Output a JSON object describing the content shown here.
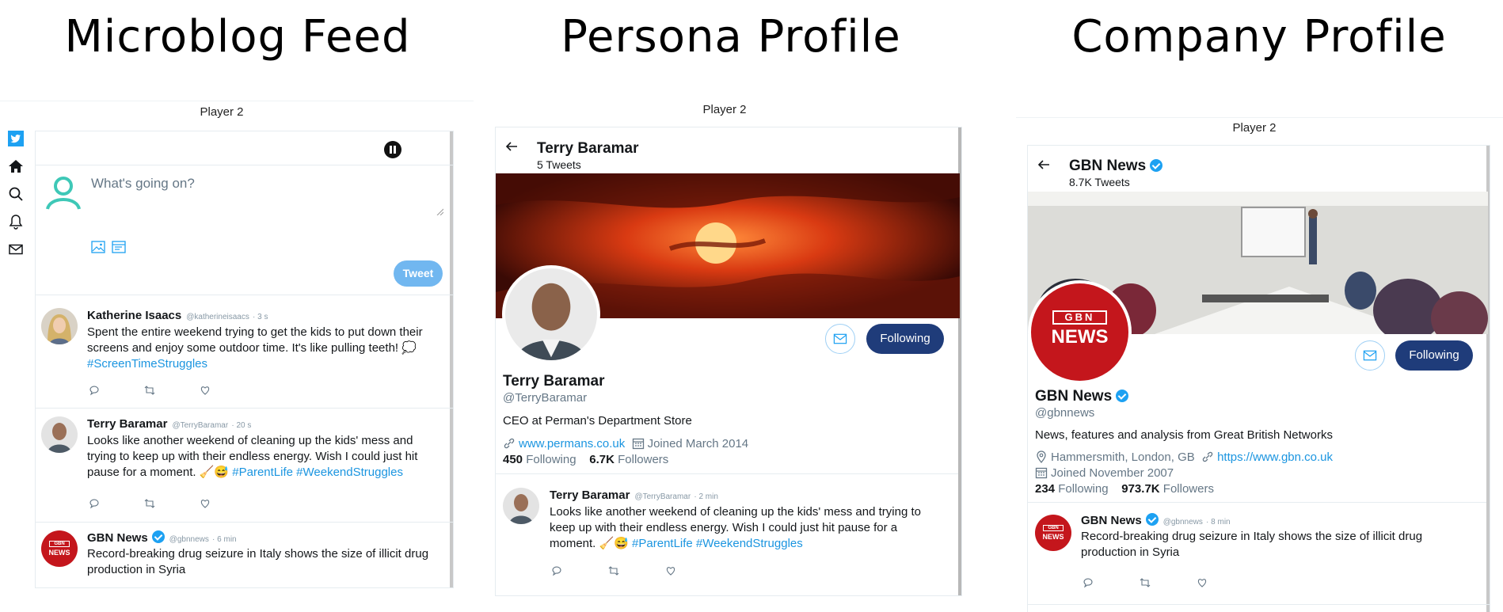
{
  "panels": {
    "feed_title": "Microblog Feed",
    "persona_title": "Persona Profile",
    "company_title": "Company Profile",
    "player_label": "Player 2"
  },
  "feed": {
    "sidebar_icons": [
      "bird-logo-icon",
      "home-icon",
      "search-icon",
      "bell-icon",
      "mail-icon"
    ],
    "compose_placeholder": "What's going on?",
    "tweet_button": "Tweet",
    "tweets": [
      {
        "name": "Katherine Isaacs",
        "handle": "@katherineisaacs",
        "time": "· 3 s",
        "text": "Spent the entire weekend trying to get the kids to put down their screens and enjoy some outdoor time. It's like pulling teeth! 💭",
        "tags": "#ScreenTimeStruggles"
      },
      {
        "name": "Terry Baramar",
        "handle": "@TerryBaramar",
        "time": "· 20 s",
        "text": "Looks like another weekend of cleaning up the kids' mess and trying to keep up with their endless energy. Wish I could just hit pause for a moment. 🧹😅",
        "tags": "#ParentLife #WeekendStruggles"
      },
      {
        "name": "GBN News",
        "handle": "@gbnnews",
        "time": "· 6 min",
        "text": "Record-breaking drug seizure in Italy shows the size of illicit drug production in Syria",
        "tags": ""
      }
    ]
  },
  "persona": {
    "name": "Terry Baramar",
    "tweet_count": "5 Tweets",
    "handle": "@TerryBaramar",
    "bio": "CEO at Perman's Department Store",
    "website": "www.permans.co.uk",
    "joined": "Joined March 2014",
    "following_count": "450",
    "following_label": "Following",
    "followers_count": "6.7K",
    "followers_label": "Followers",
    "follow_button": "Following",
    "tweet": {
      "name": "Terry Baramar",
      "handle": "@TerryBaramar",
      "time": "· 2 min",
      "text": "Looks like another weekend of cleaning up the kids' mess and trying to keep up with their endless energy. Wish I could just hit pause for a moment. 🧹😅",
      "tags": "#ParentLife #WeekendStruggles"
    }
  },
  "company": {
    "name": "GBN News",
    "tweet_count": "8.7K Tweets",
    "handle": "@gbnnews",
    "bio": "News, features and analysis from Great British Networks",
    "location": "Hammersmith, London, GB",
    "website": "https://www.gbn.co.uk",
    "joined": "Joined November 2007",
    "following_count": "234",
    "following_label": "Following",
    "followers_count": "973.7K",
    "followers_label": "Followers",
    "follow_button": "Following",
    "logo_top": "GBN",
    "logo_bottom": "NEWS",
    "tweet": {
      "name": "GBN News",
      "handle": "@gbnnews",
      "time": "· 8 min",
      "text": "Record-breaking drug seizure in Italy shows the size of illicit drug production in Syria"
    }
  },
  "colors": {
    "accent": "#1da1f2",
    "follow_button": "#1f3c7a",
    "brand_red": "#c4161c",
    "hashtag": "#1b95e0"
  }
}
